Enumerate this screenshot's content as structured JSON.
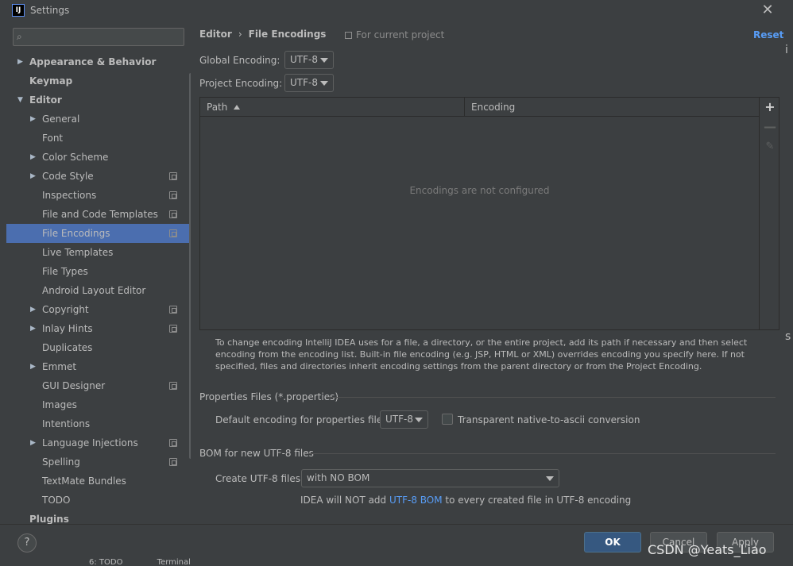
{
  "window": {
    "title": "Settings",
    "app_icon_text": "IJ",
    "close_glyph": "✕"
  },
  "search": {
    "placeholder": "",
    "icon": "search-icon"
  },
  "tree": [
    {
      "label": "Appearance & Behavior",
      "bold": true,
      "level": 0,
      "arrow": "▶",
      "project": false,
      "selected": false
    },
    {
      "label": "Keymap",
      "bold": true,
      "level": 0,
      "arrow": "",
      "project": false,
      "selected": false
    },
    {
      "label": "Editor",
      "bold": true,
      "level": 0,
      "arrow": "▼",
      "project": false,
      "selected": false
    },
    {
      "label": "General",
      "bold": false,
      "level": 1,
      "arrow": "▶",
      "project": false,
      "selected": false
    },
    {
      "label": "Font",
      "bold": false,
      "level": 1,
      "arrow": "",
      "project": false,
      "selected": false
    },
    {
      "label": "Color Scheme",
      "bold": false,
      "level": 1,
      "arrow": "▶",
      "project": false,
      "selected": false
    },
    {
      "label": "Code Style",
      "bold": false,
      "level": 1,
      "arrow": "▶",
      "project": true,
      "selected": false
    },
    {
      "label": "Inspections",
      "bold": false,
      "level": 1,
      "arrow": "",
      "project": true,
      "selected": false
    },
    {
      "label": "File and Code Templates",
      "bold": false,
      "level": 1,
      "arrow": "",
      "project": true,
      "selected": false
    },
    {
      "label": "File Encodings",
      "bold": false,
      "level": 1,
      "arrow": "",
      "project": true,
      "selected": true
    },
    {
      "label": "Live Templates",
      "bold": false,
      "level": 1,
      "arrow": "",
      "project": false,
      "selected": false
    },
    {
      "label": "File Types",
      "bold": false,
      "level": 1,
      "arrow": "",
      "project": false,
      "selected": false
    },
    {
      "label": "Android Layout Editor",
      "bold": false,
      "level": 1,
      "arrow": "",
      "project": false,
      "selected": false
    },
    {
      "label": "Copyright",
      "bold": false,
      "level": 1,
      "arrow": "▶",
      "project": true,
      "selected": false
    },
    {
      "label": "Inlay Hints",
      "bold": false,
      "level": 1,
      "arrow": "▶",
      "project": true,
      "selected": false
    },
    {
      "label": "Duplicates",
      "bold": false,
      "level": 1,
      "arrow": "",
      "project": false,
      "selected": false
    },
    {
      "label": "Emmet",
      "bold": false,
      "level": 1,
      "arrow": "▶",
      "project": false,
      "selected": false
    },
    {
      "label": "GUI Designer",
      "bold": false,
      "level": 1,
      "arrow": "",
      "project": true,
      "selected": false
    },
    {
      "label": "Images",
      "bold": false,
      "level": 1,
      "arrow": "",
      "project": false,
      "selected": false
    },
    {
      "label": "Intentions",
      "bold": false,
      "level": 1,
      "arrow": "",
      "project": false,
      "selected": false
    },
    {
      "label": "Language Injections",
      "bold": false,
      "level": 1,
      "arrow": "▶",
      "project": true,
      "selected": false
    },
    {
      "label": "Spelling",
      "bold": false,
      "level": 1,
      "arrow": "",
      "project": true,
      "selected": false
    },
    {
      "label": "TextMate Bundles",
      "bold": false,
      "level": 1,
      "arrow": "",
      "project": false,
      "selected": false
    },
    {
      "label": "TODO",
      "bold": false,
      "level": 1,
      "arrow": "",
      "project": false,
      "selected": false
    },
    {
      "label": "Plugins",
      "bold": true,
      "level": 0,
      "arrow": "",
      "project": false,
      "selected": false
    }
  ],
  "header": {
    "crumb_parent": "Editor",
    "crumb_sep": "›",
    "crumb_current": "File Encodings",
    "scope_note": "For current project",
    "reset_label": "Reset"
  },
  "encodings": {
    "global_label": "Global Encoding:",
    "global_value": "UTF-8",
    "project_label": "Project Encoding:",
    "project_value": "UTF-8"
  },
  "table": {
    "col_path": "Path",
    "col_encoding": "Encoding",
    "empty_text": "Encodings are not configured",
    "add_glyph": "+",
    "remove_glyph": "—",
    "edit_glyph": "✎"
  },
  "help_text": "To change encoding IntelliJ IDEA uses for a file, a directory, or the entire project, add its path if necessary and then select encoding from the encoding list. Built-in file encoding (e.g. JSP, HTML or XML) overrides encoding you specify here. If not specified, files and directories inherit encoding settings from the parent directory or from the Project Encoding.",
  "properties": {
    "section_title": "Properties Files (*.properties)",
    "default_label": "Default encoding for properties files:",
    "default_value": "UTF-8",
    "native_label": "Transparent native-to-ascii conversion",
    "native_checked": false
  },
  "bom": {
    "section_title": "BOM for new UTF-8 files",
    "create_label": "Create UTF-8 files:",
    "create_value": "with NO BOM",
    "note_before": "IDEA will NOT add ",
    "note_link": "UTF-8 BOM",
    "note_after": " to every created file in UTF-8 encoding"
  },
  "footer": {
    "help_glyph": "?",
    "ok_label": "OK",
    "cancel_label": "Cancel",
    "apply_label": "Apply"
  },
  "underlay": {
    "todo_tab": "6: TODO",
    "terminal_tab": "Terminal",
    "edge_glyph_1": "i",
    "edge_glyph_2": "s"
  },
  "watermark": "CSDN @Yeats_Liao",
  "colors": {
    "background": "#3c3f41",
    "selection": "#4b6eaf",
    "link": "#589df6",
    "ok_button": "#365880"
  }
}
